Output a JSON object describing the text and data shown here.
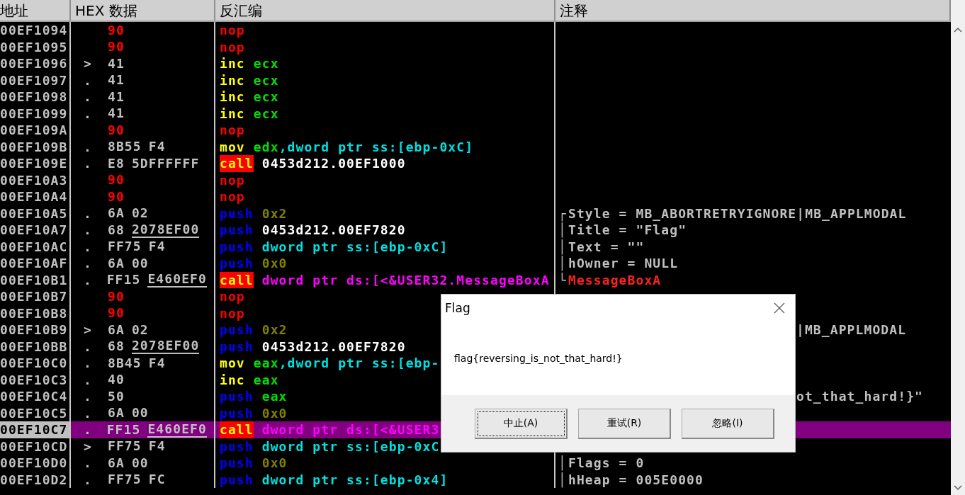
{
  "columns": [
    "地址",
    "HEX 数据",
    "反汇编",
    "注释"
  ],
  "rows": [
    {
      "address": "00EF1094",
      "marker": "",
      "hex": [
        {
          "text": "90",
          "kind": "nop",
          "underlined": false
        }
      ],
      "asm": [
        {
          "text": "nop",
          "kind": "nop"
        }
      ],
      "selected": false
    },
    {
      "address": "00EF1095",
      "marker": "",
      "hex": [
        {
          "text": "90",
          "kind": "nop",
          "underlined": false
        }
      ],
      "asm": [
        {
          "text": "nop",
          "kind": "nop"
        }
      ],
      "selected": false
    },
    {
      "address": "00EF1096",
      "marker": ">",
      "hex": [
        {
          "text": "41",
          "kind": "plain",
          "underlined": false
        }
      ],
      "asm": [
        {
          "text": "inc",
          "kind": "op"
        },
        {
          "text": "ecx",
          "kind": "reg"
        }
      ],
      "selected": false
    },
    {
      "address": "00EF1097",
      "marker": ".",
      "hex": [
        {
          "text": "41",
          "kind": "plain",
          "underlined": false
        }
      ],
      "asm": [
        {
          "text": "inc",
          "kind": "op"
        },
        {
          "text": "ecx",
          "kind": "reg"
        }
      ],
      "selected": false
    },
    {
      "address": "00EF1098",
      "marker": ".",
      "hex": [
        {
          "text": "41",
          "kind": "plain",
          "underlined": false
        }
      ],
      "asm": [
        {
          "text": "inc",
          "kind": "op"
        },
        {
          "text": "ecx",
          "kind": "reg"
        }
      ],
      "selected": false
    },
    {
      "address": "00EF1099",
      "marker": ".",
      "hex": [
        {
          "text": "41",
          "kind": "plain",
          "underlined": false
        }
      ],
      "asm": [
        {
          "text": "inc",
          "kind": "op"
        },
        {
          "text": "ecx",
          "kind": "reg"
        }
      ],
      "selected": false
    },
    {
      "address": "00EF109A",
      "marker": "",
      "hex": [
        {
          "text": "90",
          "kind": "nop",
          "underlined": false
        }
      ],
      "asm": [
        {
          "text": "nop",
          "kind": "nop"
        }
      ],
      "selected": false
    },
    {
      "address": "00EF109B",
      "marker": ".",
      "hex": [
        {
          "text": "8B55",
          "kind": "plain",
          "underlined": false
        },
        {
          "text": "F4",
          "kind": "plain",
          "underlined": false
        }
      ],
      "asm": [
        {
          "text": "mov",
          "kind": "op"
        },
        {
          "text": "edx",
          "kind": "reg"
        },
        {
          "text": ",dword ptr ss:[ebp-0xC]",
          "kind": "mem"
        }
      ],
      "selected": false
    },
    {
      "address": "00EF109E",
      "marker": ".",
      "hex": [
        {
          "text": "E8",
          "kind": "plain",
          "underlined": false
        },
        {
          "text": "5DFFFFFF",
          "kind": "plain",
          "underlined": false
        }
      ],
      "asm": [
        {
          "text": "call",
          "kind": "call"
        },
        {
          "text": "0453d212.00EF1000",
          "kind": "addr"
        }
      ],
      "selected": false
    },
    {
      "address": "00EF10A3",
      "marker": "",
      "hex": [
        {
          "text": "90",
          "kind": "nop",
          "underlined": false
        }
      ],
      "asm": [
        {
          "text": "nop",
          "kind": "nop"
        }
      ],
      "selected": false
    },
    {
      "address": "00EF10A4",
      "marker": "",
      "hex": [
        {
          "text": "90",
          "kind": "nop",
          "underlined": false
        }
      ],
      "asm": [
        {
          "text": "nop",
          "kind": "nop"
        }
      ],
      "selected": false
    },
    {
      "address": "00EF10A5",
      "marker": ".",
      "hex": [
        {
          "text": "6A",
          "kind": "plain",
          "underlined": false
        },
        {
          "text": "02",
          "kind": "plain",
          "underlined": false
        }
      ],
      "asm": [
        {
          "text": "push",
          "kind": "push"
        },
        {
          "text": "0x2",
          "kind": "imm"
        }
      ],
      "comment": {
        "text": "Style = MB_ABORTRETRYIGNORE|MB_APPLMODAL",
        "kind": "arg",
        "bracket": "┌"
      },
      "selected": false
    },
    {
      "address": "00EF10A7",
      "marker": ".",
      "hex": [
        {
          "text": "68",
          "kind": "plain",
          "underlined": false
        },
        {
          "text": "2078EF00",
          "kind": "plain",
          "underlined": true
        }
      ],
      "asm": [
        {
          "text": "push",
          "kind": "push"
        },
        {
          "text": "0453d212.00EF7820",
          "kind": "addr"
        }
      ],
      "comment": {
        "text": "Title = \"Flag\"",
        "kind": "arg",
        "bracket": "│"
      },
      "selected": false
    },
    {
      "address": "00EF10AC",
      "marker": ".",
      "hex": [
        {
          "text": "FF75",
          "kind": "plain",
          "underlined": false
        },
        {
          "text": "F4",
          "kind": "plain",
          "underlined": false
        }
      ],
      "asm": [
        {
          "text": "push",
          "kind": "push"
        },
        {
          "text": "dword ptr ss:[ebp-0xC]",
          "kind": "mem"
        }
      ],
      "comment": {
        "text": "Text = \"\"",
        "kind": "arg",
        "bracket": "│"
      },
      "selected": false
    },
    {
      "address": "00EF10AF",
      "marker": ".",
      "hex": [
        {
          "text": "6A",
          "kind": "plain",
          "underlined": false
        },
        {
          "text": "00",
          "kind": "plain",
          "underlined": false
        }
      ],
      "asm": [
        {
          "text": "push",
          "kind": "push"
        },
        {
          "text": "0x0",
          "kind": "imm"
        }
      ],
      "comment": {
        "text": "hOwner = NULL",
        "kind": "arg",
        "bracket": "│"
      },
      "selected": false
    },
    {
      "address": "00EF10B1",
      "marker": ".",
      "hex": [
        {
          "text": "FF15",
          "kind": "plain",
          "underlined": false
        },
        {
          "text": "E460EF0",
          "kind": "plain",
          "underlined": true
        }
      ],
      "asm": [
        {
          "text": "call",
          "kind": "call"
        },
        {
          "text": "dword ptr ds:[<&USER32.MessageBoxA",
          "kind": "import"
        }
      ],
      "comment": {
        "text": "MessageBoxA",
        "kind": "func",
        "bracket": "└"
      },
      "selected": false
    },
    {
      "address": "00EF10B7",
      "marker": "",
      "hex": [
        {
          "text": "90",
          "kind": "nop",
          "underlined": false
        }
      ],
      "asm": [
        {
          "text": "nop",
          "kind": "nop"
        }
      ],
      "selected": false
    },
    {
      "address": "00EF10B8",
      "marker": "",
      "hex": [
        {
          "text": "90",
          "kind": "nop",
          "underlined": false
        }
      ],
      "asm": [
        {
          "text": "nop",
          "kind": "nop"
        }
      ],
      "selected": false
    },
    {
      "address": "00EF10B9",
      "marker": ">",
      "hex": [
        {
          "text": "6A",
          "kind": "plain",
          "underlined": false
        },
        {
          "text": "02",
          "kind": "plain",
          "underlined": false
        }
      ],
      "asm": [
        {
          "text": "push",
          "kind": "push"
        },
        {
          "text": "0x2",
          "kind": "imm"
        }
      ],
      "comment": {
        "text": "|MB_APPLMODAL",
        "kind": "covered"
      },
      "selected": false
    },
    {
      "address": "00EF10BB",
      "marker": ".",
      "hex": [
        {
          "text": "68",
          "kind": "plain",
          "underlined": false
        },
        {
          "text": "2078EF00",
          "kind": "plain",
          "underlined": true
        }
      ],
      "asm": [
        {
          "text": "push",
          "kind": "push"
        },
        {
          "text": "0453d212.00EF7820",
          "kind": "addr"
        }
      ],
      "selected": false
    },
    {
      "address": "00EF10C0",
      "marker": ".",
      "hex": [
        {
          "text": "8B45",
          "kind": "plain",
          "underlined": false
        },
        {
          "text": "F4",
          "kind": "plain",
          "underlined": false
        }
      ],
      "asm": [
        {
          "text": "mov",
          "kind": "op"
        },
        {
          "text": "eax",
          "kind": "reg"
        },
        {
          "text": ",dword ptr ss:[ebp-",
          "kind": "mem"
        }
      ],
      "selected": false
    },
    {
      "address": "00EF10C3",
      "marker": ".",
      "hex": [
        {
          "text": "40",
          "kind": "plain",
          "underlined": false
        }
      ],
      "asm": [
        {
          "text": "inc",
          "kind": "op"
        },
        {
          "text": "eax",
          "kind": "reg"
        }
      ],
      "selected": false
    },
    {
      "address": "00EF10C4",
      "marker": ".",
      "hex": [
        {
          "text": "50",
          "kind": "plain",
          "underlined": false
        }
      ],
      "asm": [
        {
          "text": "push",
          "kind": "push"
        },
        {
          "text": "eax",
          "kind": "reg"
        }
      ],
      "comment": {
        "text": "ot_that_hard!}\"",
        "kind": "covered"
      },
      "selected": false
    },
    {
      "address": "00EF10C5",
      "marker": ".",
      "hex": [
        {
          "text": "6A",
          "kind": "plain",
          "underlined": false
        },
        {
          "text": "00",
          "kind": "plain",
          "underlined": false
        }
      ],
      "asm": [
        {
          "text": "push",
          "kind": "push"
        },
        {
          "text": "0x0",
          "kind": "imm"
        }
      ],
      "selected": false
    },
    {
      "address": "00EF10C7",
      "marker": ".",
      "hex": [
        {
          "text": "FF15",
          "kind": "plain",
          "underlined": false
        },
        {
          "text": "E460EF0",
          "kind": "plain",
          "underlined": true
        }
      ],
      "asm": [
        {
          "text": "call",
          "kind": "call"
        },
        {
          "text": "dword ptr ds:[<&USER3",
          "kind": "import"
        }
      ],
      "selected": true
    },
    {
      "address": "00EF10CD",
      "marker": ">",
      "hex": [
        {
          "text": "FF75",
          "kind": "plain",
          "underlined": false
        },
        {
          "text": "F4",
          "kind": "plain",
          "underlined": false
        }
      ],
      "asm": [
        {
          "text": "push",
          "kind": "push"
        },
        {
          "text": "dword ptr ss:[ebp-0xC",
          "kind": "mem"
        }
      ],
      "selected": false
    },
    {
      "address": "00EF10D0",
      "marker": ".",
      "hex": [
        {
          "text": "6A",
          "kind": "plain",
          "underlined": false
        },
        {
          "text": "00",
          "kind": "plain",
          "underlined": false
        }
      ],
      "asm": [
        {
          "text": "push",
          "kind": "push"
        },
        {
          "text": "0x0",
          "kind": "imm"
        }
      ],
      "comment": {
        "text": "Flags = 0",
        "kind": "arg",
        "bracket": "│"
      },
      "selected": false
    },
    {
      "address": "00EF10D2",
      "marker": ".",
      "hex": [
        {
          "text": "FF75",
          "kind": "plain",
          "underlined": false
        },
        {
          "text": "FC",
          "kind": "plain",
          "underlined": false
        }
      ],
      "asm": [
        {
          "text": "push",
          "kind": "push"
        },
        {
          "text": "dword ptr ss:[ebp-0x4]",
          "kind": "mem"
        }
      ],
      "comment": {
        "text": "hHeap = 005E0000",
        "kind": "arg",
        "bracket": "│"
      },
      "selected": false
    }
  ],
  "dialog": {
    "title": "Flag",
    "message": "flag{reversing_is_not_that_hard!}",
    "buttons": [
      {
        "label": "中止(A)",
        "focused": true
      },
      {
        "label": "重试(R)",
        "focused": false
      },
      {
        "label": "忽略(I)",
        "focused": false
      }
    ]
  }
}
